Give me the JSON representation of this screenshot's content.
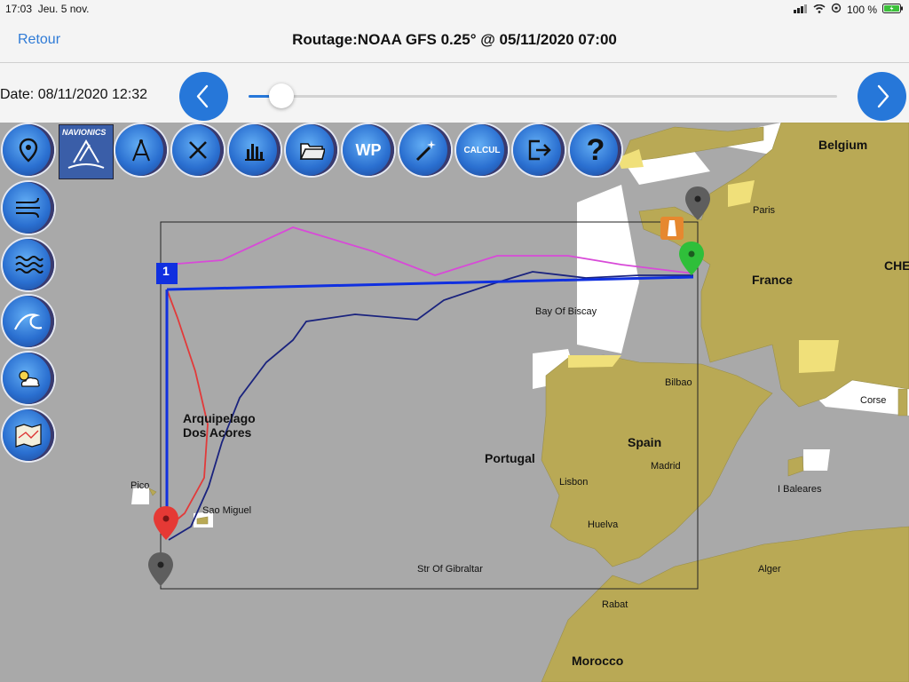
{
  "status_bar": {
    "time": "17:03",
    "date": "Jeu. 5 nov.",
    "battery": "100 %"
  },
  "nav": {
    "back_label": "Retour",
    "title": "Routage:NOAA GFS 0.25° @ 05/11/2020 07:00"
  },
  "timeline": {
    "date_label": "Date: 08/11/2020 12:32",
    "position": 0.04
  },
  "toolbar": [
    {
      "id": "pin",
      "icon": "location-pin-icon"
    },
    {
      "id": "navionics",
      "icon": "navionics-logo",
      "label": "NAVIONICS"
    },
    {
      "id": "compass",
      "icon": "divider-compass-icon"
    },
    {
      "id": "close",
      "icon": "close-icon"
    },
    {
      "id": "chart",
      "icon": "bar-chart-icon"
    },
    {
      "id": "folder",
      "icon": "folder-icon"
    },
    {
      "id": "wp",
      "icon": "waypoint-icon",
      "label": "WP"
    },
    {
      "id": "wand",
      "icon": "magic-wand-icon"
    },
    {
      "id": "calcul",
      "icon": "calculate-icon",
      "label": "CALCUL"
    },
    {
      "id": "exit",
      "icon": "exit-icon"
    },
    {
      "id": "help",
      "icon": "help-icon",
      "label": "?"
    }
  ],
  "side_tools": [
    {
      "id": "wind",
      "icon": "wind-icon"
    },
    {
      "id": "waves",
      "icon": "waves-icon"
    },
    {
      "id": "swell",
      "icon": "swell-icon"
    },
    {
      "id": "weather",
      "icon": "weather-icon"
    },
    {
      "id": "map",
      "icon": "map-icon"
    }
  ],
  "map": {
    "labels": {
      "belgium": "Belgium",
      "paris": "Paris",
      "france": "France",
      "che": "CHE",
      "biscay": "Bay Of Biscay",
      "bilbao": "Bilbao",
      "corse": "Corse",
      "acores": "Arquipelago\nDos Acores",
      "spain": "Spain",
      "madrid": "Madrid",
      "portugal": "Portugal",
      "lisbon": "Lisbon",
      "baleares": "I Baleares",
      "pico": "Pico",
      "saomiguel": "Sao Miguel",
      "huelva": "Huelva",
      "gibraltar": "Str Of Gibraltar",
      "alger": "Alger",
      "rabat": "Rabat",
      "morocco": "Morocco",
      "waypoint_number": "1"
    },
    "colors": {
      "sea": "#a9a9a9",
      "land": "#b9a955",
      "route_magenta": "#d84ad8",
      "route_red": "#e23a3a",
      "route_navy": "#1a237e",
      "route_blue": "#1030e0",
      "marker_green": "#2fbf3a",
      "marker_red": "#e53935",
      "marker_gray": "#5e5e5e"
    }
  }
}
